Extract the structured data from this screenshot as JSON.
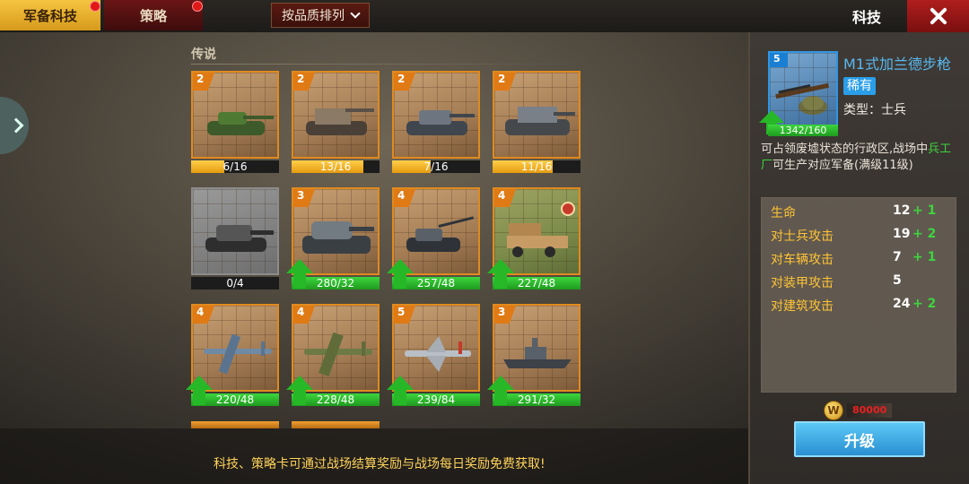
{
  "tabs": {
    "military_tech": "军备科技",
    "strategy": "策略"
  },
  "sort": {
    "label": "按品质排列"
  },
  "page_title": "科技",
  "section": {
    "label": "传说"
  },
  "cards": [
    {
      "level": "2",
      "progress": "6/16",
      "progress_fraction": 0.375,
      "upgradable": false,
      "kind": "tank-green"
    },
    {
      "level": "2",
      "progress": "13/16",
      "progress_fraction": 0.8125,
      "upgradable": false,
      "kind": "spg"
    },
    {
      "level": "2",
      "progress": "7/16",
      "progress_fraction": 0.4375,
      "upgradable": false,
      "kind": "tank-gray"
    },
    {
      "level": "2",
      "progress": "11/16",
      "progress_fraction": 0.6875,
      "upgradable": false,
      "kind": "tank-destroyer"
    },
    {
      "level": "",
      "progress": "0/4",
      "progress_fraction": 0,
      "upgradable": false,
      "kind": "tank-heavy",
      "locked": true
    },
    {
      "level": "3",
      "progress": "280/32",
      "upgradable": true,
      "kind": "tank-super-heavy"
    },
    {
      "level": "4",
      "progress": "257/48",
      "upgradable": true,
      "kind": "tank-long-gun"
    },
    {
      "level": "4",
      "progress": "227/48",
      "upgradable": true,
      "kind": "rocket-truck"
    },
    {
      "level": "4",
      "progress": "220/48",
      "upgradable": true,
      "kind": "bomber-blue"
    },
    {
      "level": "4",
      "progress": "228/48",
      "upgradable": true,
      "kind": "bomber-green"
    },
    {
      "level": "5",
      "progress": "239/84",
      "upgradable": true,
      "kind": "jet"
    },
    {
      "level": "3",
      "progress": "291/32",
      "upgradable": true,
      "kind": "battleship"
    }
  ],
  "detail": {
    "level": "5",
    "progress": "1342/160",
    "name": "M1式加兰德步枪",
    "rarity": "稀有",
    "type": "类型：士兵",
    "desc_pre": "可占领废墟状态的行政区,战场中",
    "desc_highlight": "兵工厂",
    "desc_post": "可生产对应军备(满级11级)",
    "stats": [
      {
        "label": "生命",
        "value": "12",
        "plus": "+ 1"
      },
      {
        "label": "对士兵攻击",
        "value": "19",
        "plus": "+ 2"
      },
      {
        "label": "对车辆攻击",
        "value": "7",
        "plus": "+ 1"
      },
      {
        "label": "对装甲攻击",
        "value": "5",
        "plus": ""
      },
      {
        "label": "对建筑攻击",
        "value": "24",
        "plus": "+ 2"
      }
    ],
    "cost_value": "80000",
    "upgrade_label": "升级"
  },
  "tip": "科技、策略卡可通过战场结算奖励与战场每日奖励免费获取!",
  "colors": {
    "accent_orange": "#e08a1e",
    "green": "#27b827",
    "blue": "#2a8fd0",
    "red": "#b01e1e"
  }
}
